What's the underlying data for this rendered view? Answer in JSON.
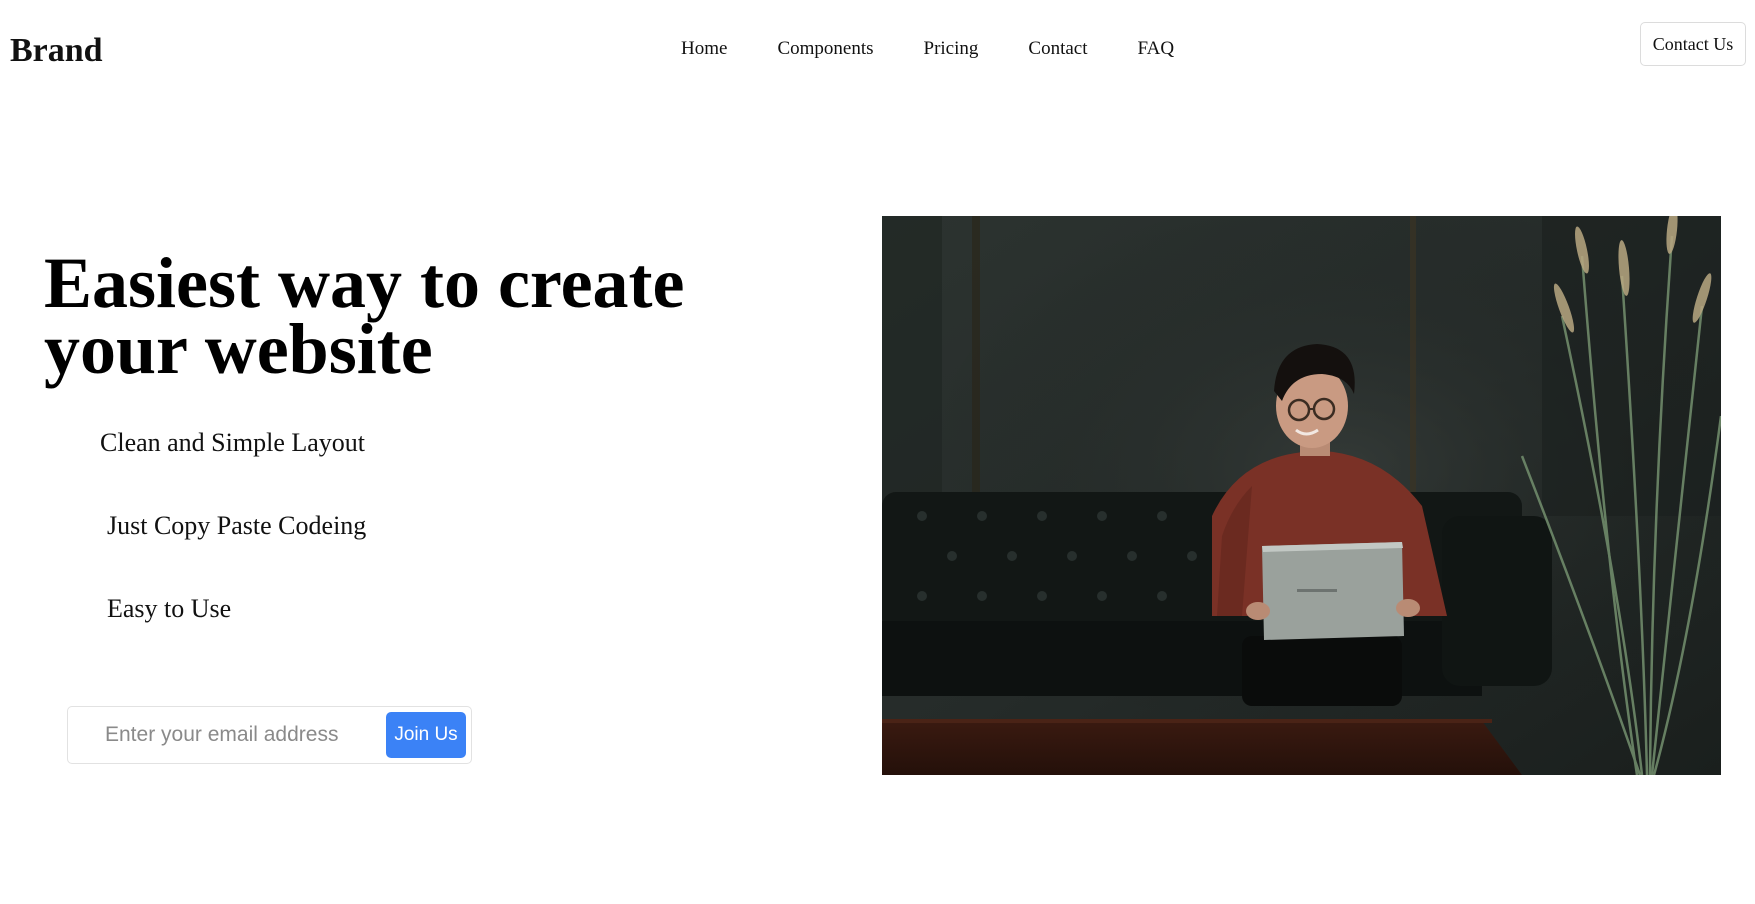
{
  "header": {
    "brand": "Brand",
    "nav": [
      "Home",
      "Components",
      "Pricing",
      "Contact",
      "FAQ"
    ],
    "contact_button": "Contact Us"
  },
  "hero": {
    "title_line1": "Easiest way to create",
    "title_line2": "your website",
    "features": [
      "Clean and Simple Layout",
      "Just Copy Paste Codeing",
      "Easy to Use"
    ],
    "signup": {
      "placeholder": "Enter your email address",
      "value": "",
      "button": "Join Us"
    },
    "image": {
      "subject": "person-with-laptop-on-sofa-photo"
    }
  },
  "colors": {
    "accent": "#3b82f6",
    "text": "#111111",
    "background": "#ffffff"
  }
}
